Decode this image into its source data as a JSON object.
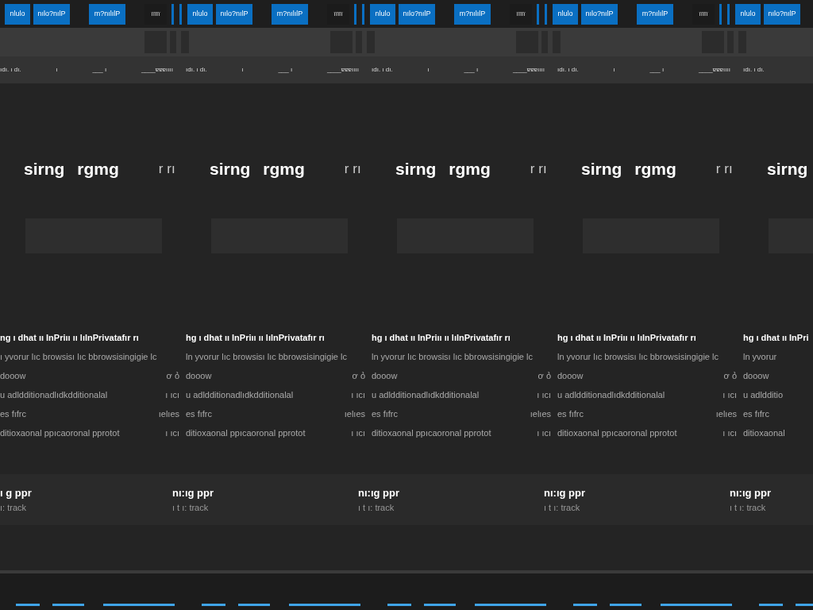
{
  "tabs": [
    {
      "kind": "short",
      "label": "nlulo"
    },
    {
      "kind": "long",
      "label": "nılo?nılP"
    },
    {
      "kind": "long",
      "label": "m?nılılP"
    },
    {
      "kind": "plain",
      "label": "îïïïï"
    },
    {
      "kind": "sliver"
    },
    {
      "kind": "sliver"
    },
    {
      "kind": "short",
      "label": "nlulo"
    },
    {
      "kind": "long",
      "label": "nılo?nılP"
    },
    {
      "kind": "long",
      "label": "m?nılılP"
    },
    {
      "kind": "plain",
      "label": "îïïïï"
    },
    {
      "kind": "sliver"
    },
    {
      "kind": "sliver"
    },
    {
      "kind": "short",
      "label": "nlulo"
    },
    {
      "kind": "long",
      "label": "nılo?nılP"
    },
    {
      "kind": "long",
      "label": "m?nılılP"
    },
    {
      "kind": "plain",
      "label": "îïïïï"
    },
    {
      "kind": "sliver"
    },
    {
      "kind": "sliver"
    },
    {
      "kind": "short",
      "label": "nlulo"
    },
    {
      "kind": "long",
      "label": "nılo?nılP"
    },
    {
      "kind": "long",
      "label": "m?nılılP"
    },
    {
      "kind": "plain",
      "label": "îïïïï"
    },
    {
      "kind": "sliver"
    },
    {
      "kind": "sliver"
    },
    {
      "kind": "short",
      "label": "nlulo"
    },
    {
      "kind": "long",
      "label": "nılo?nılP"
    }
  ],
  "favorites": [
    [
      "ıdı. ı dı.",
      "ı",
      "___ ı",
      "____ɐɐɐıııı"
    ],
    [
      "ıdı. ı dı.",
      "ı",
      "___ ı",
      "____ɐɐɐıııı"
    ],
    [
      "ıdı. ı dı.",
      "ı",
      "___ ı",
      "____ɐɐɐıııı"
    ],
    [
      "ıdı. ı dı.",
      "ı",
      "___ ı",
      "____ɐɐɐıııı"
    ],
    [
      "ıdı. ı dı."
    ]
  ],
  "heading_items": [
    {
      "title": "sirng",
      "title_2": "rgmg",
      "mark": "r rı"
    },
    {
      "title": "sirng",
      "title_2": "rgmg",
      "mark": "r rı"
    },
    {
      "title": "sirng",
      "title_2": "rgmg",
      "mark": "r rı"
    },
    {
      "title": "sirng",
      "title_2": "rgmg",
      "mark": "r rı"
    },
    {
      "title": "sirng"
    }
  ],
  "paragraph_rows": [
    {
      "kind": "strong",
      "units": [
        [
          "ng ı dhat ıı InPriıı ıı lılnPrivatafır rı"
        ],
        [
          "hg ı dhat ıı InPriıı ıı lılnPrivatafır rı"
        ],
        [
          "hg ı dhat ıı InPriıı ıı lılnPrivatafır rı"
        ],
        [
          "hg ı dhat ıı InPriıı ıı lılnPrivatafır rı"
        ],
        [
          "hg ı dhat ıı InPri"
        ]
      ]
    },
    {
      "kind": "muted",
      "units": [
        [
          "ı yvorur lıc browsisı lıc bbrowsisingigie lc"
        ],
        [
          "ln yvorur lıc browsisı lıc bbrowsisingigie lc"
        ],
        [
          "ln yvorur lıc browsisı lıc bbrowsisingigie lc"
        ],
        [
          "ln yvorur lıc browsisı lıc bbrowsisingigie lc"
        ],
        [
          "ln yvorur"
        ]
      ]
    },
    {
      "kind": "muted",
      "units": [
        [
          "dooow",
          "ơ ỏ"
        ],
        [
          "dooow",
          "ơ ỏ"
        ],
        [
          "dooow",
          "ơ ỏ"
        ],
        [
          "dooow",
          "ơ ỏ"
        ],
        [
          "dooow"
        ]
      ]
    },
    {
      "kind": "muted",
      "units": [
        [
          "u adldditionadlıdkdditionalal",
          "ı ıcı"
        ],
        [
          "u adldditionadlıdkdditionalal",
          "ı ıcı"
        ],
        [
          "u adldditionadlıdkdditionalal",
          "ı ıcı"
        ],
        [
          "u adldditionadlıdkdditionalal",
          "ı ıcı"
        ],
        [
          "u adldditio"
        ]
      ]
    },
    {
      "kind": "muted",
      "units": [
        [
          "es fıfrc",
          "ıelıes"
        ],
        [
          "es fıfrc",
          "ıelıes"
        ],
        [
          "es fıfrc",
          "ıelıes"
        ],
        [
          "es fıfrc",
          "ıelıes"
        ],
        [
          "es fıfrc"
        ]
      ]
    },
    {
      "kind": "muted",
      "units": [
        [
          "ditioxaonal ppıcaoronal pprotot",
          "ı ıcı"
        ],
        [
          "ditioxaonal ppıcaoronal pprotot",
          "ı ıcı"
        ],
        [
          "ditioxaonal ppıcaoronal pprotot",
          "ı ıcı"
        ],
        [
          "ditioxaonal ppıcaoronal pprotot",
          "ı ıcı"
        ],
        [
          "ditioxaonal"
        ]
      ]
    }
  ],
  "card_items": [
    {
      "title": "ı g ppr",
      "subtitle": "ı: track"
    },
    {
      "title": "nı:ıg ppr",
      "subtitle": "ı t ı: track"
    },
    {
      "title": "nı:ıg ppr",
      "subtitle": "ı t ı: track"
    },
    {
      "title": "nı:ıg ppr",
      "subtitle": "ı t ı: track"
    },
    {
      "title": "nı:ıg ppr",
      "subtitle": "ı t ı: track"
    }
  ]
}
